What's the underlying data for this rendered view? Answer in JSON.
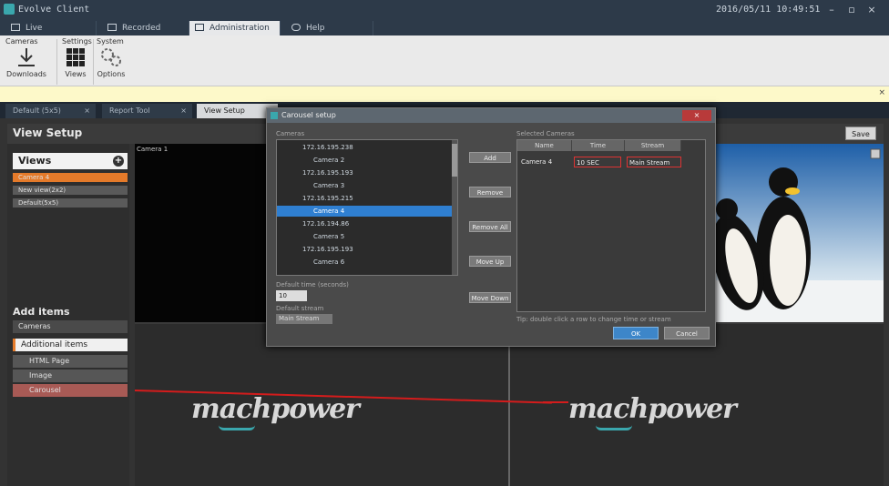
{
  "window": {
    "title": "Evolve Client",
    "clock": "2016/05/11 10:49:51",
    "controls": [
      "–",
      "▫",
      "×"
    ]
  },
  "main_tabs": [
    "Live",
    "Recorded",
    "Administration",
    "Help"
  ],
  "ribbon": {
    "groups": [
      "Cameras",
      "Settings",
      "System"
    ],
    "buttons": [
      "Downloads",
      "Views",
      "Options"
    ]
  },
  "sub_tabs": [
    "Default (5x5)",
    "Report Tool",
    "View Setup"
  ],
  "view_setup": {
    "title": "View Setup",
    "save_label": "Save"
  },
  "views_panel": {
    "header": "Views",
    "items": [
      "Camera 4",
      "New view(2x2)",
      "Default(5x5)"
    ]
  },
  "add_items": {
    "title": "Add items",
    "items": [
      "Cameras",
      "Additional items",
      "HTML Page",
      "Image",
      "Carousel"
    ]
  },
  "camera_cell": {
    "label": "Camera 1"
  },
  "logo_text": "machpower",
  "dialog": {
    "title": "Carousel setup",
    "tree_label": "Cameras",
    "selected_label": "Selected Cameras",
    "tree": [
      "172.16.195.238",
      "Camera 2",
      "172.16.195.193",
      "Camera 3",
      "172.16.195.215",
      "Camera 4",
      "172.16.194.86",
      "Camera 5",
      "172.16.195.193",
      "Camera 6"
    ],
    "buttons": [
      "Add",
      "Remove",
      "Remove All",
      "Move Up",
      "Move Down"
    ],
    "columns": [
      "Name",
      "Time",
      "Stream"
    ],
    "row": {
      "name": "Camera 4",
      "time": "10 SEC",
      "stream": "Main Stream"
    },
    "default_time_label": "Default time (seconds)",
    "default_time_value": "10",
    "default_stream_label": "Default stream",
    "default_stream_value": "Main Stream",
    "hint": "Tip: double click a row to change time or stream",
    "ok_label": "OK",
    "cancel_label": "Cancel"
  },
  "colors": {
    "accent_orange": "#e47a2a",
    "selection_blue": "#2f7fd1",
    "annotation_red": "#d41c1c"
  }
}
